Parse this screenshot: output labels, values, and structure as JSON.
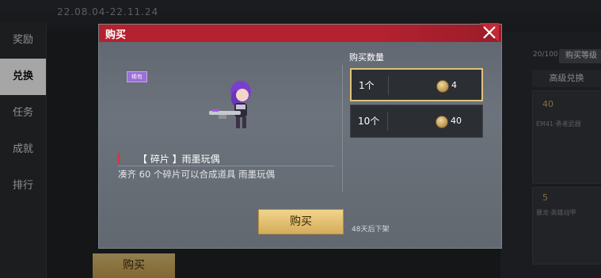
{
  "background": {
    "date_range": "22.08.04-22.11.24",
    "sidebar": [
      "奖励",
      "兑换",
      "任务",
      "成就",
      "排行"
    ],
    "active_sidebar": "兑换",
    "progress_count": "20/100",
    "level_button": "购买等级",
    "advanced_tab": "高级兑换",
    "card_price_1": "40",
    "card_price_2": "5",
    "card_text_1": "EM41·勇者武器",
    "card_text_2": "暴龙·英雄战甲",
    "left_buy_button": "购买"
  },
  "modal": {
    "title": "购买",
    "rarity_tag": "稀有",
    "item_name": "【 碎片 】雨墨玩偶",
    "item_desc": "凑齐 60 个碎片可以合成道具 雨墨玩偶",
    "quantity_label": "购买数量",
    "options": [
      {
        "amount": "1个",
        "price": "4"
      },
      {
        "amount": "10个",
        "price": "40"
      }
    ],
    "buy_button": "购买",
    "expire_note": "48天后下架"
  },
  "colors": {
    "header_red": "#b4212f",
    "gold": "#e2c27a",
    "accent_purple": "#9a6fd6"
  }
}
